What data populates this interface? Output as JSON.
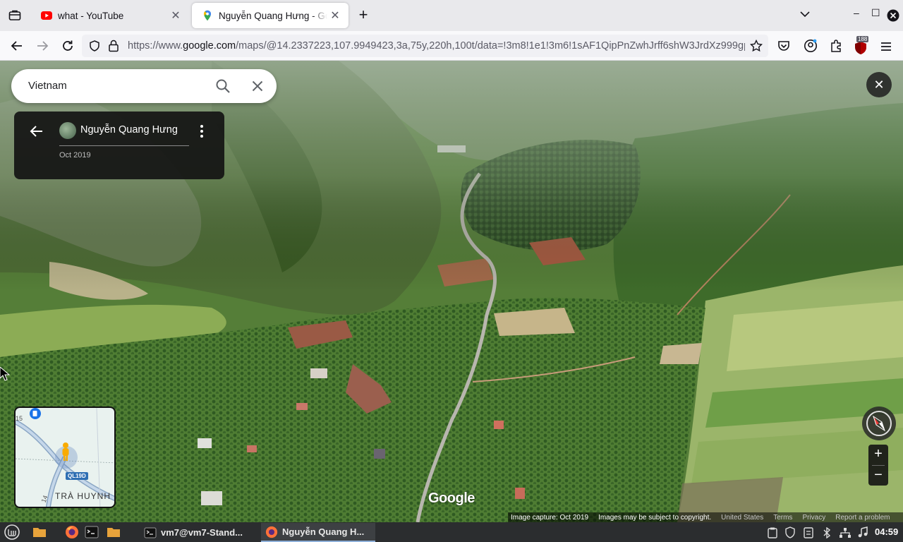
{
  "browser": {
    "tabs": [
      {
        "title": "what - YouTube",
        "favicon": "youtube-icon",
        "active": false
      },
      {
        "title": "Nguyễn Quang Hưng - Google Maps",
        "favicon": "google-maps-icon",
        "active": true
      }
    ],
    "url_prefix": "https://www.",
    "url_domain": "google.com",
    "url_rest": "/maps/@14.2337223,107.9949423,3a,75y,220h,100t/data=!3m8!1e1!3m6!1sAF1QipPnZwhJrff6shW3JrdXz999gp",
    "extension_badge": "188"
  },
  "maps": {
    "search_query": "Vietnam",
    "contributor_name": "Nguyễn Quang Hưng",
    "capture_date": "Oct 2019",
    "minimap": {
      "road_label": "QL19D",
      "place_label": "TRÀ HUYNH",
      "side_number": "15",
      "corner_number": "14"
    },
    "logo": "Google",
    "footer": {
      "image_capture": "Image capture: Oct 2019",
      "copyright": "Images may be subject to copyright.",
      "links": [
        "United States",
        "Terms",
        "Privacy",
        "Report a problem"
      ]
    }
  },
  "taskbar": {
    "windows": [
      {
        "label": "vm7@vm7-Stand...",
        "icon": "terminal-icon"
      },
      {
        "label": "Nguyễn Quang H...",
        "icon": "firefox-icon"
      }
    ],
    "clock": "04:59"
  },
  "colors": {
    "tab_strip": "#e9e9ec",
    "nav_bar": "#f9f9fb",
    "taskbar": "#2b2d2f",
    "youtube_red": "#ff0000",
    "minimap_road": "#2f6fb3"
  }
}
